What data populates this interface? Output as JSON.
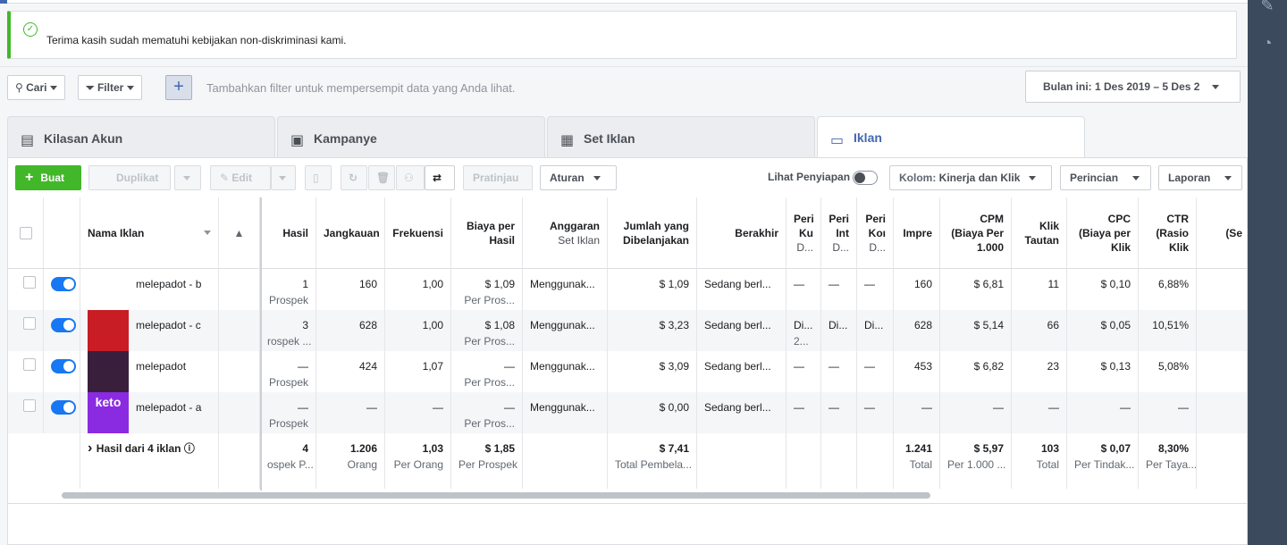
{
  "notice": {
    "text": "Terima kasih sudah mematuhi kebijakan non-diskriminasi kami."
  },
  "filterbar": {
    "search": "Cari",
    "filter": "Filter",
    "hint": "Tambahkan filter untuk mempersempit data yang Anda lihat.",
    "date": "Bulan ini: 1 Des 2019 – 5 Des 2"
  },
  "tabs": [
    "Kilasan Akun",
    "Kampanye",
    "Set Iklan",
    "Iklan"
  ],
  "toolbar": {
    "create": "Buat",
    "duplicate": "Duplikat",
    "edit": "Edit",
    "preview": "Pratinjau",
    "rules": "Aturan",
    "view_setup": "Lihat Penyiapan",
    "columns_prefix": "Kolom: ",
    "columns_value": "Kinerja dan Klik",
    "breakdown": "Perincian",
    "reports": "Laporan"
  },
  "columns": [
    {
      "label": "Hasil",
      "sub": ""
    },
    {
      "label": "Jangkauan",
      "sub": ""
    },
    {
      "label": "Frekuensi",
      "sub": ""
    },
    {
      "label": "Biaya per",
      "label2": "Hasil"
    },
    {
      "label": "Anggaran",
      "sub": "Set Iklan"
    },
    {
      "label": "Jumlah yang",
      "label2": "Dibelanjakan"
    },
    {
      "label": "Berakhir",
      "sub": ""
    },
    {
      "label": "Peri",
      "label2": "Ku",
      "sub": "D..."
    },
    {
      "label": "Peri",
      "label2": "Int",
      "sub": "D..."
    },
    {
      "label": "Peri",
      "label2": "Koı",
      "sub": "D..."
    },
    {
      "label": "Impre",
      "sub": ""
    },
    {
      "label": "CPM",
      "label2": "(Biaya Per",
      "label3": "1.000"
    },
    {
      "label": "Klik",
      "label2": "Tautan"
    },
    {
      "label": "CPC",
      "label2": "(Biaya per",
      "label3": "Klik"
    },
    {
      "label": "CTR",
      "label2": "(Rasio",
      "label3": "Klik"
    },
    {
      "label": "(Se",
      "sub": ""
    }
  ],
  "name_header": "Nama Iklan",
  "rows": [
    {
      "name": "melepadot - b",
      "thumb_color": "#ffffff",
      "cells": [
        [
          "1",
          "Prospek"
        ],
        [
          "160",
          ""
        ],
        [
          "1,00",
          ""
        ],
        [
          "$ 1,09",
          "Per Pros..."
        ],
        [
          "Menggunak...",
          ""
        ],
        [
          "$ 1,09",
          ""
        ],
        [
          "Sedang berl...",
          ""
        ],
        [
          "—",
          ""
        ],
        [
          "—",
          ""
        ],
        [
          "—",
          ""
        ],
        [
          "160",
          ""
        ],
        [
          "$ 6,81",
          ""
        ],
        [
          "11",
          ""
        ],
        [
          "$ 0,10",
          ""
        ],
        [
          "6,88%",
          ""
        ]
      ]
    },
    {
      "name": "melepadot - c",
      "thumb_color": "#c81d25",
      "cells": [
        [
          "3",
          "rospek ..."
        ],
        [
          "628",
          ""
        ],
        [
          "1,00",
          ""
        ],
        [
          "$ 1,08",
          "Per Pros..."
        ],
        [
          "Menggunak...",
          ""
        ],
        [
          "$ 3,23",
          ""
        ],
        [
          "Sedang berl...",
          ""
        ],
        [
          "Di...",
          "2..."
        ],
        [
          "Di...",
          ""
        ],
        [
          "Di...",
          ""
        ],
        [
          "628",
          ""
        ],
        [
          "$ 5,14",
          ""
        ],
        [
          "66",
          ""
        ],
        [
          "$ 0,05",
          ""
        ],
        [
          "10,51%",
          ""
        ]
      ]
    },
    {
      "name": "melepadot",
      "thumb_color": "#3a1f3d",
      "cells": [
        [
          "—",
          "Prospek"
        ],
        [
          "424",
          ""
        ],
        [
          "1,07",
          ""
        ],
        [
          "—",
          "Per Pros..."
        ],
        [
          "Menggunak...",
          ""
        ],
        [
          "$ 3,09",
          ""
        ],
        [
          "Sedang berl...",
          ""
        ],
        [
          "—",
          ""
        ],
        [
          "—",
          ""
        ],
        [
          "—",
          ""
        ],
        [
          "453",
          ""
        ],
        [
          "$ 6,82",
          ""
        ],
        [
          "23",
          ""
        ],
        [
          "$ 0,13",
          ""
        ],
        [
          "5,08%",
          ""
        ]
      ]
    },
    {
      "name": "melepadot - a",
      "thumb_color": "#8a2be2",
      "thumb_text": "keto",
      "cells": [
        [
          "—",
          "Prospek"
        ],
        [
          "—",
          ""
        ],
        [
          "—",
          ""
        ],
        [
          "—",
          "Per Pros..."
        ],
        [
          "Menggunak...",
          ""
        ],
        [
          "$ 0,00",
          ""
        ],
        [
          "Sedang berl...",
          ""
        ],
        [
          "—",
          ""
        ],
        [
          "—",
          ""
        ],
        [
          "—",
          ""
        ],
        [
          "—",
          ""
        ],
        [
          "—",
          ""
        ],
        [
          "—",
          ""
        ],
        [
          "—",
          ""
        ],
        [
          "—",
          ""
        ]
      ]
    }
  ],
  "total": {
    "label": "Hasil dari 4 iklan",
    "cells": [
      [
        "4",
        "ospek P..."
      ],
      [
        "1.206",
        "Orang"
      ],
      [
        "1,03",
        "Per Orang"
      ],
      [
        "$ 1,85",
        "Per Prospek"
      ],
      [
        "",
        ""
      ],
      [
        "$ 7,41",
        "Total Pembela..."
      ],
      [
        "",
        ""
      ],
      [
        "",
        ""
      ],
      [
        "",
        ""
      ],
      [
        "",
        ""
      ],
      [
        "1.241",
        "Total"
      ],
      [
        "$ 5,97",
        "Per 1.000 ..."
      ],
      [
        "103",
        "Total"
      ],
      [
        "$ 0,07",
        "Per Tindak..."
      ],
      [
        "8,30%",
        "Per Taya..."
      ]
    ]
  },
  "thumb_caption_b": "ℹ️"
}
